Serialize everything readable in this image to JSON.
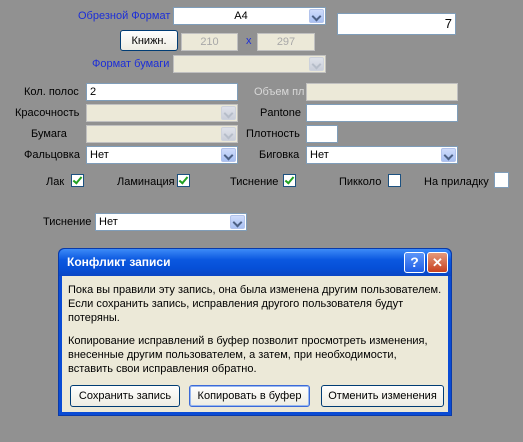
{
  "form": {
    "trim_format_label": "Обрезной Формат",
    "trim_format_value": "A4",
    "pages_count_right": "7",
    "orientation_button": "Книжн.",
    "width_value": "210",
    "times_sign": "x",
    "height_value": "297",
    "paper_format_label": "Формат бумаги",
    "paper_format_value": "",
    "bands_label": "Кол. полос",
    "bands_value": "2",
    "volume_label": "Объем пл",
    "volume_value": "",
    "chromaticity_label": "Красочность",
    "chromaticity_value": "",
    "pantone_label": "Pantone",
    "pantone_value": "",
    "paper_label": "Бумага",
    "paper_value": "",
    "density_label": "Плотность",
    "density_value": "",
    "folding_label": "Фальцовка",
    "folding_value": "Нет",
    "creasing_label": "Биговка",
    "creasing_value": "Нет",
    "varnish_label": "Лак",
    "varnish_checked": true,
    "lamination_label": "Ламинация",
    "lamination_checked": true,
    "embossing_label": "Тиснение",
    "embossing_checked": true,
    "piccolo_label": "Пикколо",
    "piccolo_checked": false,
    "allowance_label": "На приладку",
    "allowance_value": "",
    "embossing_type_label": "Тиснение",
    "embossing_type_value": "Нет"
  },
  "dialog": {
    "title": "Конфликт записи",
    "help_glyph": "?",
    "close_glyph": "✕",
    "message1_line1": "Пока вы правили эту запись, она была изменена другим пользователем.",
    "message1_line2": "Если сохранить запись, исправления другого пользователя будут",
    "message1_line3": "потеряны.",
    "message2_line1": "Копирование исправлений в буфер позволит просмотреть изменения,",
    "message2_line2": "внесенные другим пользователем, а затем, при необходимости,",
    "message2_line3": "вставить свои исправления обратно.",
    "save_button": "Сохранить запись",
    "copy_button": "Копировать в буфер",
    "cancel_button": "Отменить изменения"
  }
}
